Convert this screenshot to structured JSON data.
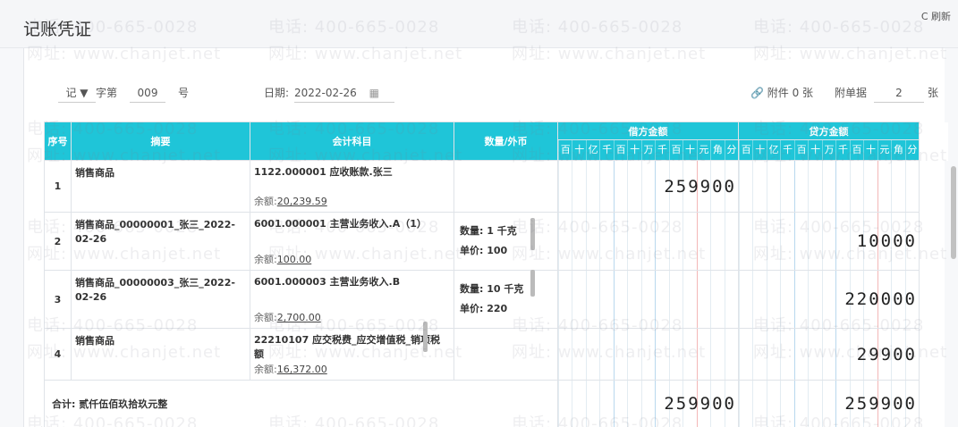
{
  "window": {
    "title": "记账凭证",
    "refresh_label": "C 刷新"
  },
  "toolbar": {
    "voucher_type": "记",
    "zi_label": "字第",
    "voucher_no": "009",
    "hao_label": "号",
    "date_label": "日期:",
    "date_value": "2022-02-26",
    "attachment_label": "附件 0 张",
    "doc_label": "附单据",
    "doc_count": "2",
    "zhang": "张"
  },
  "watermark": {
    "phone": "电话: 400-665-0028",
    "site": "网址: www.chanjet.net"
  },
  "headers": {
    "no": "序号",
    "summary": "摘要",
    "account": "会计科目",
    "qty": "数量/外币",
    "debit": "借方金额",
    "credit": "贷方金额",
    "digits": [
      "百",
      "十",
      "亿",
      "千",
      "百",
      "十",
      "万",
      "千",
      "百",
      "十",
      "元",
      "角",
      "分"
    ]
  },
  "rows": [
    {
      "no": "1",
      "summary": "销售商品",
      "account": "1122.000001 应收账款.张三",
      "balance_label": "余额:",
      "balance": "20,239.59",
      "qty_line1": "",
      "qty_line2": "",
      "debit": "259900",
      "credit": ""
    },
    {
      "no": "2",
      "summary": "销售商品_00000001_张三_2022-02-26",
      "account": "6001.000001 主营业务收入.A（1）",
      "balance_label": "余额:",
      "balance": "100.00",
      "qty_line1": "数量: 1 千克",
      "qty_line2": "单价: 100",
      "debit": "",
      "credit": "10000"
    },
    {
      "no": "3",
      "summary": "销售商品_00000003_张三_2022-02-26",
      "account": "6001.000003 主营业务收入.B",
      "balance_label": "余额:",
      "balance": "2,700.00",
      "qty_line1": "数量: 10 千克",
      "qty_line2": "单价: 220",
      "debit": "",
      "credit": "220000"
    },
    {
      "no": "4",
      "summary": "销售商品",
      "account": "22210107 应交税费_应交增值税_销项税额",
      "balance_label": "余额:",
      "balance": "16,372.00",
      "qty_line1": "",
      "qty_line2": "",
      "debit": "",
      "credit": "29900"
    }
  ],
  "total": {
    "label": "合计:  贰仟伍佰玖拾玖元整",
    "debit": "259900",
    "credit": "259900"
  }
}
